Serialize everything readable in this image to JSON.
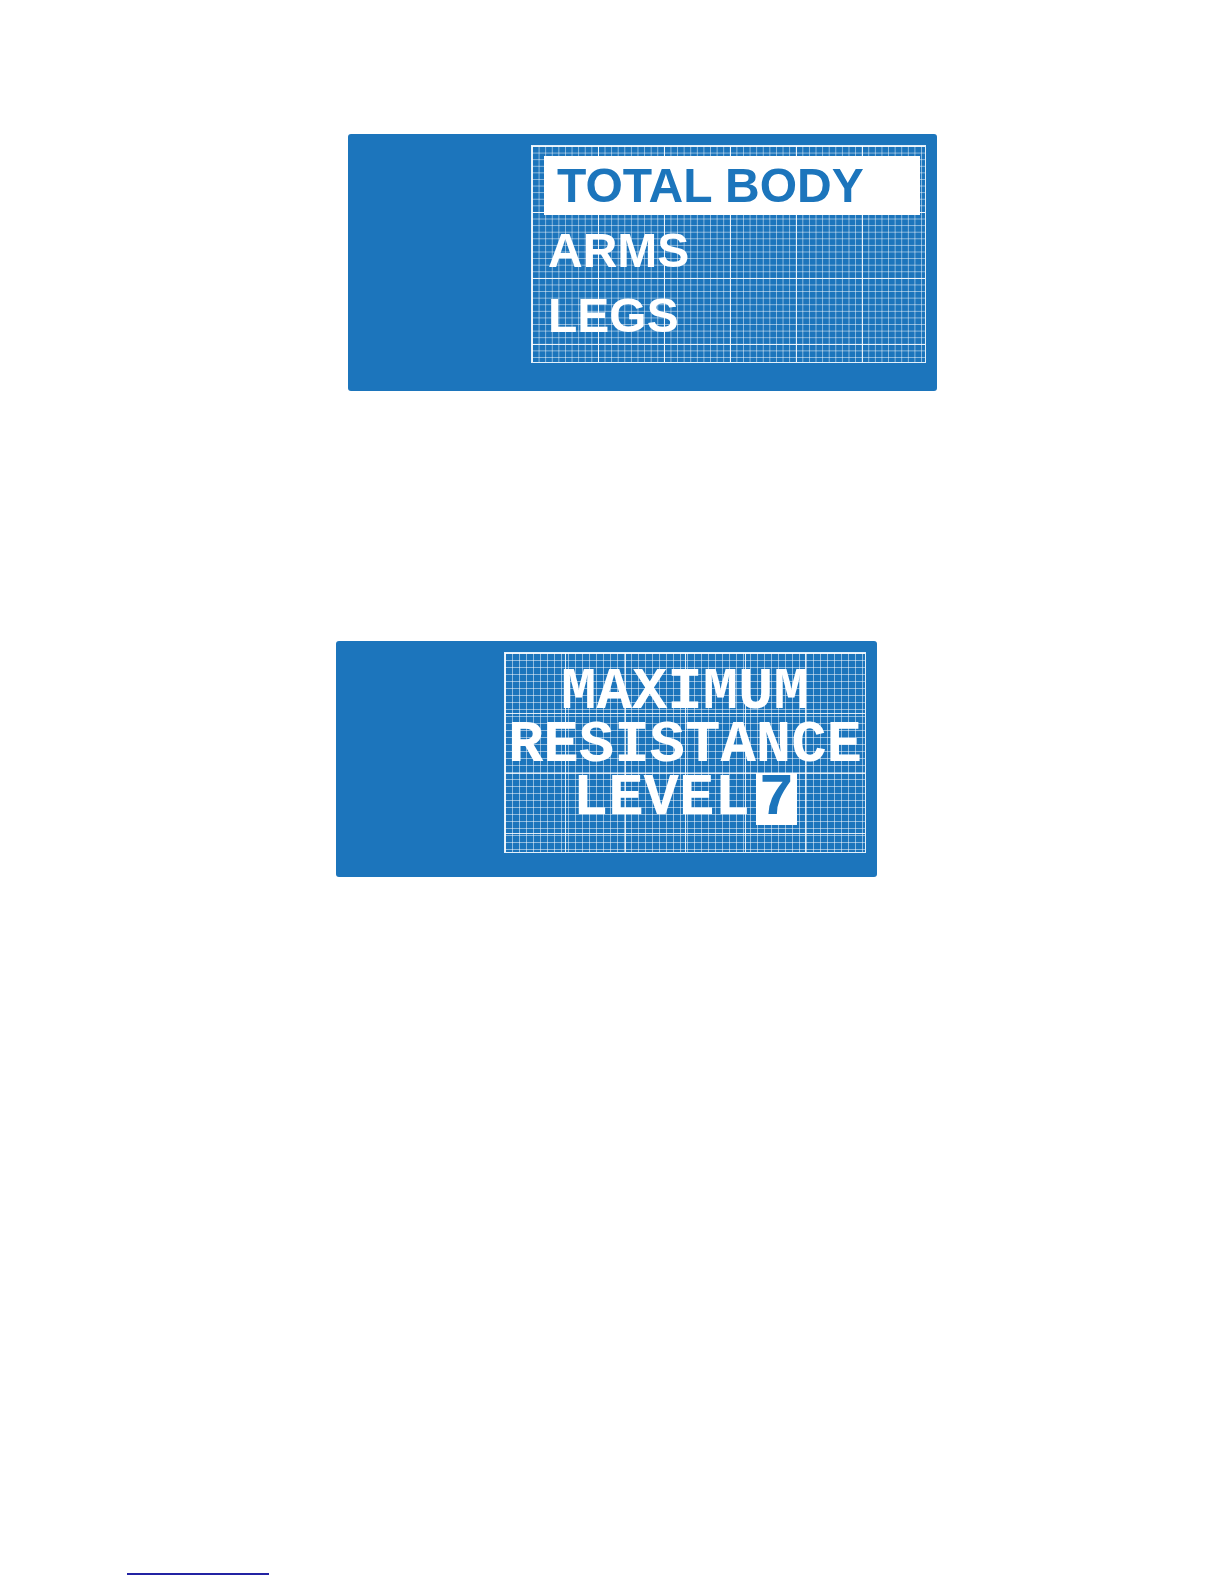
{
  "menu_display": {
    "items": [
      {
        "label": "TOTAL BODY",
        "selected": true
      },
      {
        "label": "ARMS",
        "selected": false
      },
      {
        "label": "LEGS",
        "selected": false
      }
    ]
  },
  "message_display": {
    "lines": [
      "MAXIMUM",
      "RESISTANCE"
    ],
    "setting": {
      "label": "LEVEL",
      "value": "7",
      "selected": true
    }
  }
}
